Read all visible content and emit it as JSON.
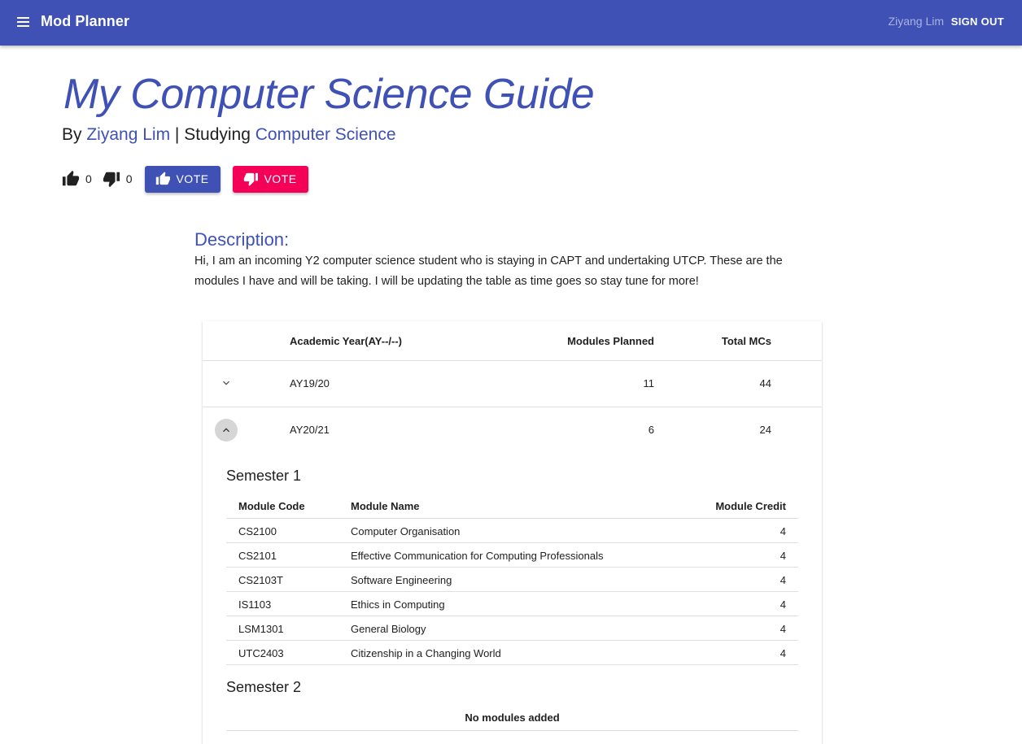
{
  "appbar": {
    "title": "Mod Planner",
    "user_name": "Ziyang Lim",
    "signout_label": "SIGN OUT"
  },
  "guide": {
    "title": "My Computer Science Guide",
    "by_prefix": "By",
    "author": "Ziyang Lim",
    "studying_prefix": "| Studying",
    "major": "Computer Science"
  },
  "votes": {
    "up_count": "0",
    "down_count": "0",
    "upvote_label": "VOTE",
    "downvote_label": "VOTE"
  },
  "description": {
    "heading": "Description:",
    "text": "Hi, I am an incoming Y2 computer science student who is staying in CAPT and undertaking UTCP. These are the modules I have and will be taking. I will be updating the table as time goes so stay tune for more!"
  },
  "year_table": {
    "headers": {
      "year": "Academic Year(AY--/--)",
      "modules": "Modules Planned",
      "mcs": "Total MCs"
    },
    "rows": [
      {
        "year": "AY19/20",
        "modules": "11",
        "mcs": "44",
        "expanded": false
      },
      {
        "year": "AY20/21",
        "modules": "6",
        "mcs": "24",
        "expanded": true
      }
    ]
  },
  "semesters": {
    "sem1": {
      "title": "Semester 1",
      "headers": {
        "code": "Module Code",
        "name": "Module Name",
        "credit": "Module Credit"
      },
      "modules": [
        {
          "code": "CS2100",
          "name": "Computer Organisation",
          "credit": "4"
        },
        {
          "code": "CS2101",
          "name": "Effective Communication for Computing Professionals",
          "credit": "4"
        },
        {
          "code": "CS2103T",
          "name": "Software Engineering",
          "credit": "4"
        },
        {
          "code": "IS1103",
          "name": "Ethics in Computing",
          "credit": "4"
        },
        {
          "code": "LSM1301",
          "name": "General Biology",
          "credit": "4"
        },
        {
          "code": "UTC2403",
          "name": "Citizenship in a Changing World",
          "credit": "4"
        }
      ]
    },
    "sem2": {
      "title": "Semester 2",
      "empty_text": "No modules added"
    }
  },
  "icons": {
    "menu": "menu-icon",
    "thumb_up": "thumb-up-icon",
    "thumb_down": "thumb-down-icon",
    "expand": "chevron-down-icon",
    "collapse": "chevron-up-icon"
  },
  "colors": {
    "primary": "#3f51b5",
    "secondary": "#f50057"
  }
}
